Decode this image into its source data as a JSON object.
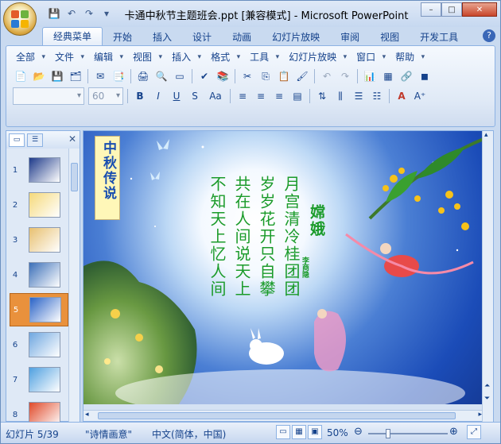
{
  "window": {
    "title": "卡通中秋节主题班会.ppt [兼容模式] - Microsoft PowerPoint",
    "controls": {
      "minimize": "–",
      "maximize": "□",
      "close": "✕"
    }
  },
  "quick_access": [
    {
      "icon": "save-icon",
      "glyph": "💾"
    },
    {
      "icon": "undo-icon",
      "glyph": "↶"
    },
    {
      "icon": "redo-icon",
      "glyph": "↷"
    },
    {
      "icon": "customize-icon",
      "glyph": "▾"
    }
  ],
  "tabs": [
    "经典菜单",
    "开始",
    "插入",
    "设计",
    "动画",
    "幻灯片放映",
    "审阅",
    "视图",
    "开发工具"
  ],
  "active_tab": "经典菜单",
  "help_label": "?",
  "menus": [
    "全部",
    "文件",
    "编辑",
    "视图",
    "插入",
    "格式",
    "工具",
    "幻灯片放映",
    "窗口",
    "帮助"
  ],
  "font_combo": {
    "value": "",
    "size": "60"
  },
  "format_buttons": {
    "bold": "B",
    "italic": "I",
    "underline": "U",
    "strike": "S",
    "case": "Aa",
    "font_color": "A"
  },
  "panel": {
    "close": "✕"
  },
  "thumbnails": [
    {
      "num": "1",
      "color": "#1e3a8a"
    },
    {
      "num": "2",
      "color": "#f5d97a"
    },
    {
      "num": "3",
      "color": "#e8c070"
    },
    {
      "num": "4",
      "color": "#3b6fb8"
    },
    {
      "num": "5",
      "color": "#2a63c7",
      "selected": true
    },
    {
      "num": "6",
      "color": "#6fa7e0"
    },
    {
      "num": "7",
      "color": "#4fa0e0"
    },
    {
      "num": "8",
      "color": "#e04a2a"
    }
  ],
  "slide": {
    "title_box": "中秋传说",
    "poem_title": "嫦娥",
    "poem_author": "李商隐",
    "poem_columns": [
      "月宫清冷桂团团",
      "岁岁花开只自攀",
      "共在人间说天上",
      "不知天上忆人间"
    ]
  },
  "status": {
    "slide": "幻灯片 5/39",
    "theme": "\"诗情画意\"",
    "language": "中文(简体，中国)",
    "zoom": "50%",
    "zoom_minus": "⊖",
    "zoom_plus": "⊕"
  },
  "colors": {
    "poem_text": "#1b9b2a",
    "selected_thumb": "#e9913c",
    "title_box_bg": "#fff7b8"
  }
}
